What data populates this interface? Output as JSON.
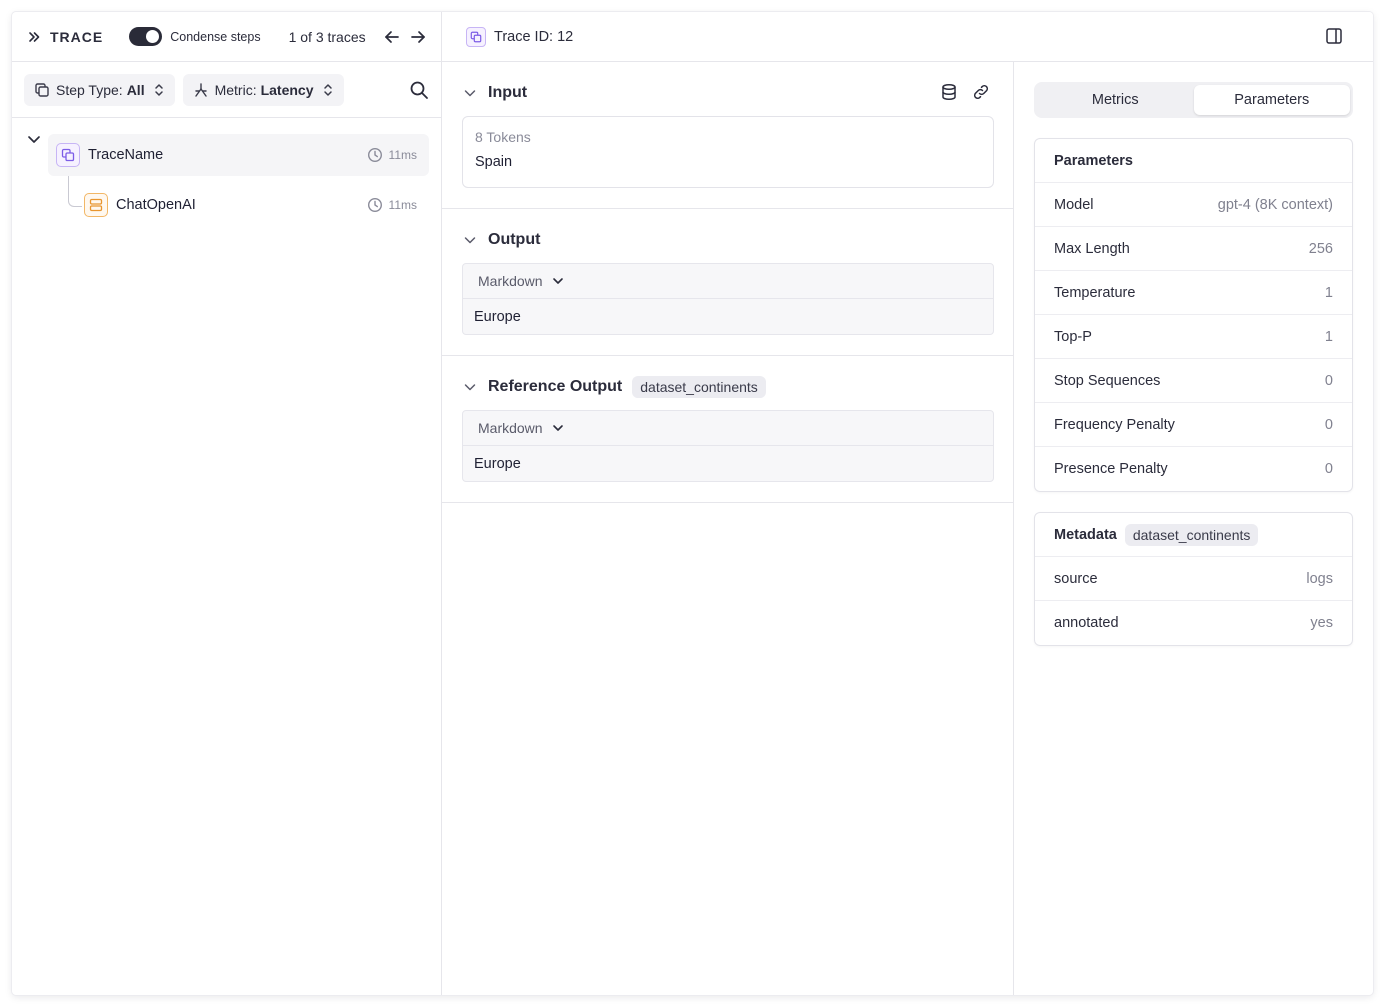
{
  "header": {
    "title": "TRACE",
    "condense_label": "Condense steps",
    "trace_count": "1 of 3 traces",
    "trace_id": "Trace ID: 12"
  },
  "filters": {
    "step_type_label": "Step Type:",
    "step_type_value": "All",
    "metric_label": "Metric:",
    "metric_value": "Latency"
  },
  "tree": {
    "root": {
      "name": "TraceName",
      "time": "11ms"
    },
    "child": {
      "name": "ChatOpenAI",
      "time": "11ms"
    }
  },
  "input": {
    "title": "Input",
    "tokens": "8 Tokens",
    "value": "Spain"
  },
  "output": {
    "title": "Output",
    "format": "Markdown",
    "value": "Europe"
  },
  "reference": {
    "title": "Reference Output",
    "tag": "dataset_continents",
    "format": "Markdown",
    "value": "Europe"
  },
  "tabs": {
    "metrics": "Metrics",
    "parameters": "Parameters",
    "active": "parameters"
  },
  "parameters": {
    "title": "Parameters",
    "rows": [
      {
        "key": "Model",
        "value": "gpt-4 (8K context)"
      },
      {
        "key": "Max Length",
        "value": "256"
      },
      {
        "key": "Temperature",
        "value": "1"
      },
      {
        "key": "Top-P",
        "value": "1"
      },
      {
        "key": "Stop Sequences",
        "value": "0"
      },
      {
        "key": "Frequency Penalty",
        "value": "0"
      },
      {
        "key": "Presence Penalty",
        "value": "0"
      }
    ]
  },
  "metadata": {
    "title": "Metadata",
    "tag": "dataset_continents",
    "rows": [
      {
        "key": "source",
        "value": "logs"
      },
      {
        "key": "annotated",
        "value": "yes"
      }
    ]
  },
  "colors": {
    "accent_purple": "#7c5ce6",
    "accent_orange": "#e8952e",
    "toggle_on": "#2a2b38"
  },
  "icons": {
    "collapse": "double-chevron-right-icon",
    "arrow_left": "arrow-left-icon",
    "arrow_right": "arrow-right-icon",
    "search": "search-icon",
    "database": "database-icon",
    "link": "link-icon",
    "clock": "clock-icon",
    "panel": "panel-right-icon"
  }
}
